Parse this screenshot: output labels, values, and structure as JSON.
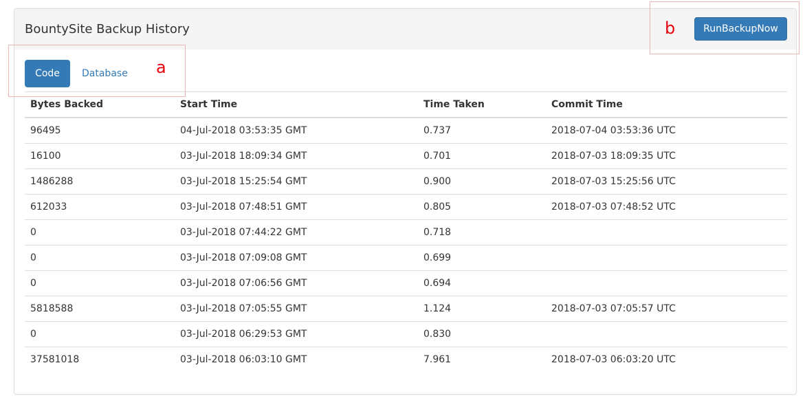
{
  "panel": {
    "title": "BountySite Backup History",
    "run_button_label": "RunBackupNow"
  },
  "annotations": {
    "a": "a",
    "b": "b"
  },
  "tabs": [
    {
      "label": "Code",
      "active": true
    },
    {
      "label": "Database",
      "active": false
    }
  ],
  "table": {
    "headers": [
      "Bytes Backed",
      "Start Time",
      "Time Taken",
      "Commit Time"
    ],
    "rows": [
      [
        "96495",
        "04-Jul-2018 03:53:35 GMT",
        "0.737",
        "2018-07-04 03:53:36 UTC"
      ],
      [
        "16100",
        "03-Jul-2018 18:09:34 GMT",
        "0.701",
        "2018-07-03 18:09:35 UTC"
      ],
      [
        "1486288",
        "03-Jul-2018 15:25:54 GMT",
        "0.900",
        "2018-07-03 15:25:56 UTC"
      ],
      [
        "612033",
        "03-Jul-2018 07:48:51 GMT",
        "0.805",
        "2018-07-03 07:48:52 UTC"
      ],
      [
        "0",
        "03-Jul-2018 07:44:22 GMT",
        "0.718",
        ""
      ],
      [
        "0",
        "03-Jul-2018 07:09:08 GMT",
        "0.699",
        ""
      ],
      [
        "0",
        "03-Jul-2018 07:06:56 GMT",
        "0.694",
        ""
      ],
      [
        "5818588",
        "03-Jul-2018 07:05:55 GMT",
        "1.124",
        "2018-07-03 07:05:57 UTC"
      ],
      [
        "0",
        "03-Jul-2018 06:29:53 GMT",
        "0.830",
        ""
      ],
      [
        "37581018",
        "03-Jul-2018 06:03:10 GMT",
        "7.961",
        "2018-07-03 06:03:20 UTC"
      ]
    ]
  },
  "colors": {
    "primary": "#337ab7",
    "annotation": "#e8000b",
    "annotation_box": "#f0b4b4",
    "heading_bg": "#f5f5f5"
  }
}
